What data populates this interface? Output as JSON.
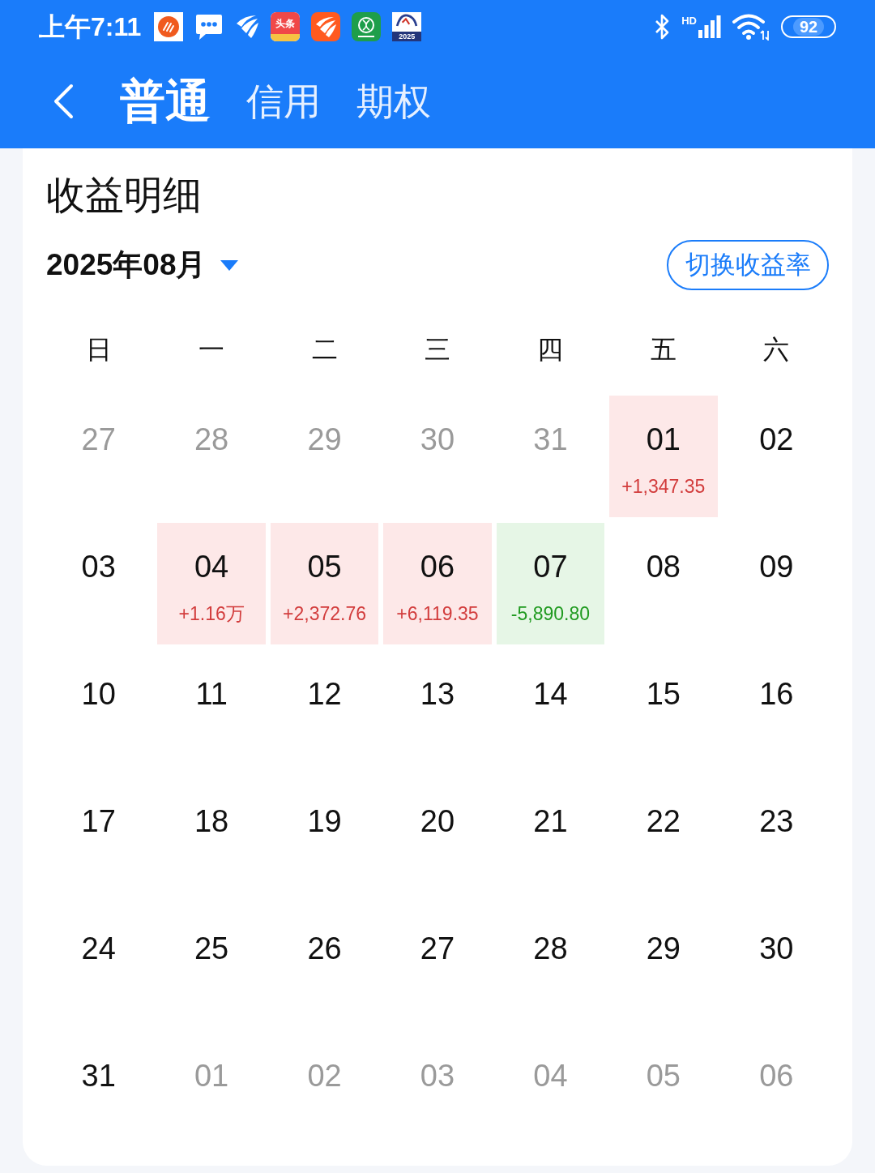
{
  "status_bar": {
    "time": "上午7:11",
    "notifications": [
      {
        "kind": "circle_app"
      },
      {
        "kind": "chat"
      },
      {
        "kind": "feather"
      },
      {
        "kind": "news_app",
        "text": "头条"
      },
      {
        "kind": "feather_app"
      },
      {
        "kind": "ring_app"
      },
      {
        "kind": "year_app",
        "text": "2025"
      }
    ],
    "network_type": "HD",
    "battery": "92"
  },
  "header": {
    "tabs": [
      {
        "label": "普通",
        "selected": true
      },
      {
        "label": "信用",
        "selected": false
      },
      {
        "label": "期权",
        "selected": false
      }
    ]
  },
  "card": {
    "title": "收益明细",
    "month": "2025年08月",
    "toggle_button": "切换收益率",
    "weekdays": [
      "日",
      "一",
      "二",
      "三",
      "四",
      "五",
      "六"
    ],
    "weeks": [
      [
        {
          "kind": "plain",
          "day": "27",
          "in_month": false
        },
        {
          "kind": "plain",
          "day": "28",
          "in_month": false
        },
        {
          "kind": "plain",
          "day": "29",
          "in_month": false
        },
        {
          "kind": "plain",
          "day": "30",
          "in_month": false
        },
        {
          "kind": "plain",
          "day": "31",
          "in_month": false
        },
        {
          "kind": "gain",
          "day": "01",
          "in_month": true,
          "profit": "+1,347.35"
        },
        {
          "kind": "plain",
          "day": "02",
          "in_month": true
        }
      ],
      [
        {
          "kind": "plain",
          "day": "03",
          "in_month": true
        },
        {
          "kind": "gain",
          "day": "04",
          "in_month": true,
          "profit": "+1.16万"
        },
        {
          "kind": "gain",
          "day": "05",
          "in_month": true,
          "profit": "+2,372.76"
        },
        {
          "kind": "gain",
          "day": "06",
          "in_month": true,
          "profit": "+6,119.35"
        },
        {
          "kind": "loss",
          "day": "07",
          "in_month": true,
          "profit": "-5,890.80"
        },
        {
          "kind": "plain",
          "day": "08",
          "in_month": true
        },
        {
          "kind": "plain",
          "day": "09",
          "in_month": true
        }
      ],
      [
        {
          "kind": "plain",
          "day": "10",
          "in_month": true
        },
        {
          "kind": "plain",
          "day": "11",
          "in_month": true
        },
        {
          "kind": "plain",
          "day": "12",
          "in_month": true
        },
        {
          "kind": "plain",
          "day": "13",
          "in_month": true
        },
        {
          "kind": "plain",
          "day": "14",
          "in_month": true
        },
        {
          "kind": "plain",
          "day": "15",
          "in_month": true
        },
        {
          "kind": "plain",
          "day": "16",
          "in_month": true
        }
      ],
      [
        {
          "kind": "plain",
          "day": "17",
          "in_month": true
        },
        {
          "kind": "plain",
          "day": "18",
          "in_month": true
        },
        {
          "kind": "plain",
          "day": "19",
          "in_month": true
        },
        {
          "kind": "plain",
          "day": "20",
          "in_month": true
        },
        {
          "kind": "plain",
          "day": "21",
          "in_month": true
        },
        {
          "kind": "plain",
          "day": "22",
          "in_month": true
        },
        {
          "kind": "plain",
          "day": "23",
          "in_month": true
        }
      ],
      [
        {
          "kind": "plain",
          "day": "24",
          "in_month": true
        },
        {
          "kind": "plain",
          "day": "25",
          "in_month": true
        },
        {
          "kind": "plain",
          "day": "26",
          "in_month": true
        },
        {
          "kind": "plain",
          "day": "27",
          "in_month": true
        },
        {
          "kind": "plain",
          "day": "28",
          "in_month": true
        },
        {
          "kind": "plain",
          "day": "29",
          "in_month": true
        },
        {
          "kind": "plain",
          "day": "30",
          "in_month": true
        }
      ],
      [
        {
          "kind": "plain",
          "day": "31",
          "in_month": true
        },
        {
          "kind": "plain",
          "day": "01",
          "in_month": false
        },
        {
          "kind": "plain",
          "day": "02",
          "in_month": false
        },
        {
          "kind": "plain",
          "day": "03",
          "in_month": false
        },
        {
          "kind": "plain",
          "day": "04",
          "in_month": false
        },
        {
          "kind": "plain",
          "day": "05",
          "in_month": false
        },
        {
          "kind": "plain",
          "day": "06",
          "in_month": false
        }
      ]
    ]
  }
}
